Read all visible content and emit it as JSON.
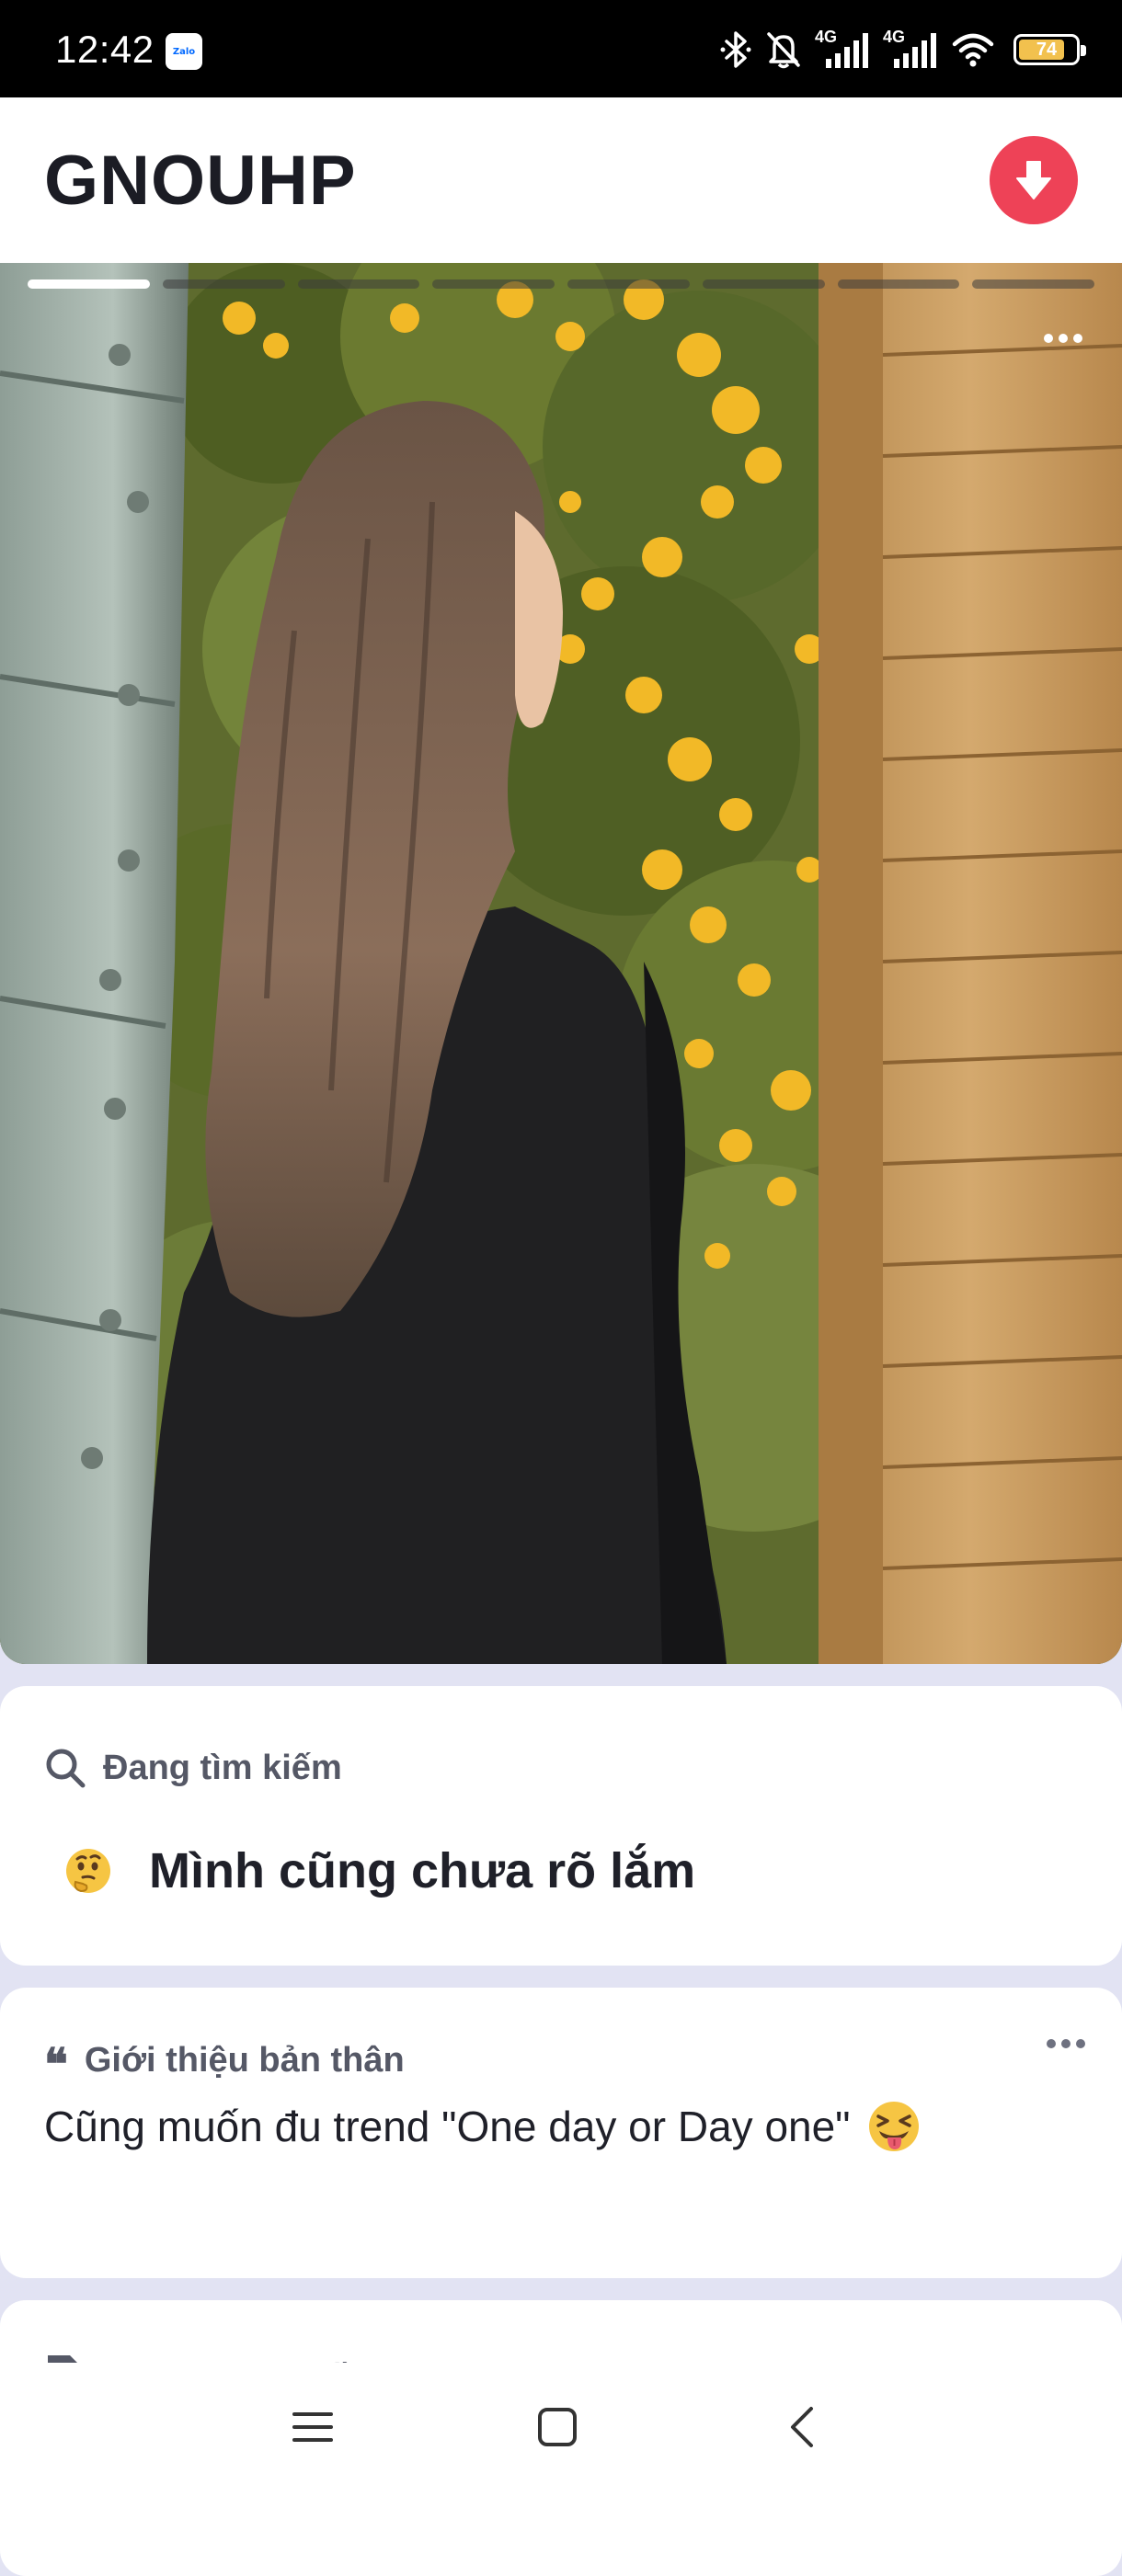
{
  "status_bar": {
    "time": "12:42",
    "notification_icon": "zalo-icon",
    "notification_label": "Zalo",
    "network_1": "4G",
    "network_2": "4G",
    "battery_percent": "74",
    "icons": [
      "bluetooth-icon",
      "bell-off-icon",
      "signal-icon",
      "signal-icon",
      "wifi-icon",
      "battery-icon"
    ]
  },
  "header": {
    "title": "GNOUHP",
    "download_icon": "arrow-down-icon",
    "accent_color": "#EE4257"
  },
  "photo": {
    "segments_total": 8,
    "active_segment": 1,
    "more_icon": "more-horizontal-icon"
  },
  "looking_for": {
    "label": "Đang tìm kiếm",
    "icon": "search-icon",
    "emoji": "thinking-face-emoji",
    "value": "Mình cũng chưa rõ lắm"
  },
  "intro": {
    "label": "Giới thiệu bản thân",
    "icon": "quote-icon",
    "quote_glyph": "❝",
    "text": "Cũng muốn đu trend \"One day or Day one\"",
    "emoji": "squinting-tongue-emoji",
    "more_icon": "more-horizontal-icon"
  },
  "third_card": {
    "label": "Phong cách sống",
    "icon": "document-icon"
  },
  "nav": {
    "icons": [
      "menu-icon",
      "home-square-icon",
      "back-icon"
    ]
  }
}
